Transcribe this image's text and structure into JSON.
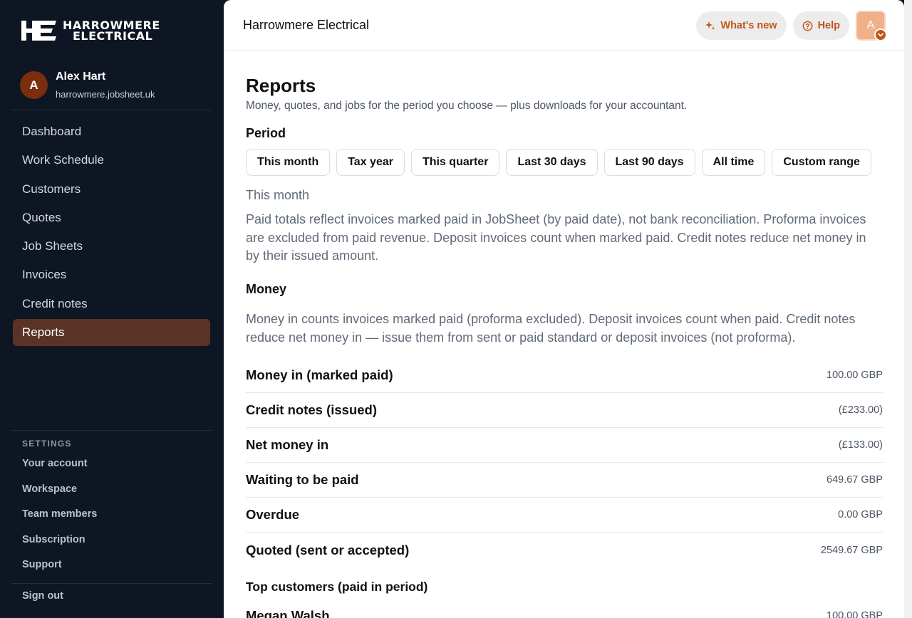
{
  "brand": {
    "logo_line1": "HARROWMERE",
    "logo_line2": "ELECTRICAL",
    "logo_mark": "HE"
  },
  "user": {
    "initial": "A",
    "name": "Alex Hart",
    "domain": "harrowmere.jobsheet.uk"
  },
  "nav": {
    "items": [
      {
        "label": "Dashboard"
      },
      {
        "label": "Work Schedule"
      },
      {
        "label": "Customers"
      },
      {
        "label": "Quotes"
      },
      {
        "label": "Job Sheets"
      },
      {
        "label": "Invoices"
      },
      {
        "label": "Credit notes"
      },
      {
        "label": "Reports"
      }
    ],
    "active": "Reports"
  },
  "settings": {
    "heading": "SETTINGS",
    "items": [
      {
        "label": "Your account"
      },
      {
        "label": "Workspace"
      },
      {
        "label": "Team members"
      },
      {
        "label": "Subscription"
      },
      {
        "label": "Support"
      }
    ],
    "sign_out": "Sign out"
  },
  "topbar": {
    "business_name": "Harrowmere Electrical",
    "whats_new": "What's new",
    "help": "Help",
    "avatar_initial": "A"
  },
  "page": {
    "title": "Reports",
    "subtitle": "Money, quotes, and jobs for the period you choose — plus downloads for your accountant.",
    "period_label": "Period",
    "period_options": [
      {
        "label": "This month"
      },
      {
        "label": "Tax year"
      },
      {
        "label": "This quarter"
      },
      {
        "label": "Last 30 days"
      },
      {
        "label": "Last 90 days"
      },
      {
        "label": "All time"
      },
      {
        "label": "Custom range"
      }
    ],
    "current_period": "This month",
    "paid_note": "Paid totals reflect invoices marked paid in JobSheet (by paid date), not bank reconciliation. Proforma invoices are excluded from paid revenue. Deposit invoices count when marked paid. Credit notes reduce net money in by their issued amount.",
    "money_heading": "Money",
    "money_note": "Money in counts invoices marked paid (proforma excluded). Deposit invoices count when paid. Credit notes reduce net money in — issue them from sent or paid standard or deposit invoices (not proforma).",
    "money_rows": [
      {
        "label": "Money in (marked paid)",
        "value": "100.00 GBP"
      },
      {
        "label": "Credit notes (issued)",
        "value": "(£233.00)"
      },
      {
        "label": "Net money in",
        "value": "(£133.00)"
      },
      {
        "label": "Waiting to be paid",
        "value": "649.67 GBP"
      },
      {
        "label": "Overdue",
        "value": "0.00 GBP"
      },
      {
        "label": "Quoted (sent or accepted)",
        "value": "2549.67 GBP"
      }
    ],
    "top_customers_heading": "Top customers (paid in period)",
    "top_customers": [
      {
        "name": "Megan Walsh",
        "value": "100.00 GBP"
      }
    ]
  },
  "colors": {
    "sidebar_bg": "#0e1624",
    "active_nav": "#5a3327",
    "accent": "#c2561a"
  }
}
